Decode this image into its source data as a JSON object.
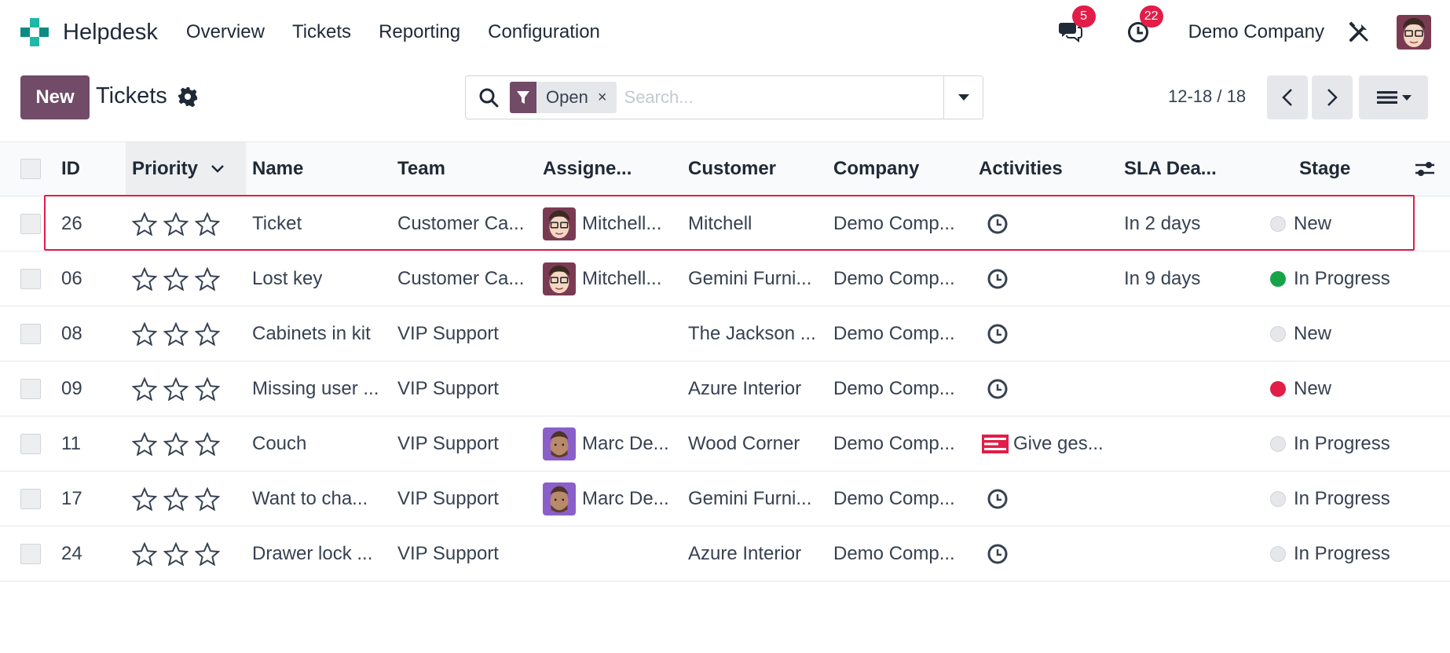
{
  "navbar": {
    "app_name": "Helpdesk",
    "menu": [
      "Overview",
      "Tickets",
      "Reporting",
      "Configuration"
    ],
    "messages_count": "5",
    "activities_count": "22",
    "company": "Demo Company"
  },
  "control": {
    "new_label": "New",
    "title": "Tickets",
    "facet_label": "Open",
    "facet_remove": "×",
    "search_placeholder": "Search...",
    "pager": "12-18 / 18"
  },
  "columns": {
    "id": "ID",
    "priority": "Priority",
    "name": "Name",
    "team": "Team",
    "assignee": "Assigne...",
    "customer": "Customer",
    "company": "Company",
    "activities": "Activities",
    "sla": "SLA Dea...",
    "stage": "Stage"
  },
  "rows": [
    {
      "id": "26",
      "name": "Ticket",
      "team": "Customer Ca...",
      "assignee": "Mitchell...",
      "assignee_avatar": "mitchell",
      "customer": "Mitchell",
      "company": "Demo Comp...",
      "activity": "clock",
      "activity_text": "",
      "sla": "In 2 days",
      "stage_dot": "gray",
      "stage": "New"
    },
    {
      "id": "06",
      "name": "Lost key",
      "team": "Customer Ca...",
      "assignee": "Mitchell...",
      "assignee_avatar": "mitchell",
      "customer": "Gemini Furni...",
      "company": "Demo Comp...",
      "activity": "clock",
      "activity_text": "",
      "sla": "In 9 days",
      "stage_dot": "green",
      "stage": "In Progress"
    },
    {
      "id": "08",
      "name": "Cabinets in kit",
      "team": "VIP Support",
      "assignee": "",
      "assignee_avatar": "",
      "customer": "The Jackson ...",
      "company": "Demo Comp...",
      "activity": "clock",
      "activity_text": "",
      "sla": "",
      "stage_dot": "gray",
      "stage": "New"
    },
    {
      "id": "09",
      "name": "Missing user ...",
      "team": "VIP Support",
      "assignee": "",
      "assignee_avatar": "",
      "customer": "Azure Interior",
      "company": "Demo Comp...",
      "activity": "clock",
      "activity_text": "",
      "sla": "",
      "stage_dot": "red",
      "stage": "New"
    },
    {
      "id": "11",
      "name": "Couch",
      "team": "VIP Support",
      "assignee": "Marc De...",
      "assignee_avatar": "marc",
      "customer": "Wood Corner",
      "company": "Demo Comp...",
      "activity": "overdue",
      "activity_text": "Give ges...",
      "sla": "",
      "stage_dot": "gray",
      "stage": "In Progress"
    },
    {
      "id": "17",
      "name": "Want to cha...",
      "team": "VIP Support",
      "assignee": "Marc De...",
      "assignee_avatar": "marc",
      "customer": "Gemini Furni...",
      "company": "Demo Comp...",
      "activity": "clock",
      "activity_text": "",
      "sla": "",
      "stage_dot": "gray",
      "stage": "In Progress"
    },
    {
      "id": "24",
      "name": "Drawer lock ...",
      "team": "VIP Support",
      "assignee": "",
      "assignee_avatar": "",
      "customer": "Azure Interior",
      "company": "Demo Comp...",
      "activity": "clock",
      "activity_text": "",
      "sla": "",
      "stage_dot": "gray",
      "stage": "In Progress"
    }
  ],
  "colors": {
    "brand": "#714b67",
    "badge": "#e11d48",
    "highlight": "#e11d48",
    "stage_green": "#16a34a",
    "stage_red": "#e11d48"
  },
  "icons": {
    "messages": "chat-bubbles-icon",
    "activities": "clock-icon",
    "debug": "tools-icon",
    "search": "search-icon",
    "filter": "funnel-icon",
    "settings": "gear-icon",
    "view": "list-view-icon",
    "optional_columns": "sliders-icon"
  }
}
